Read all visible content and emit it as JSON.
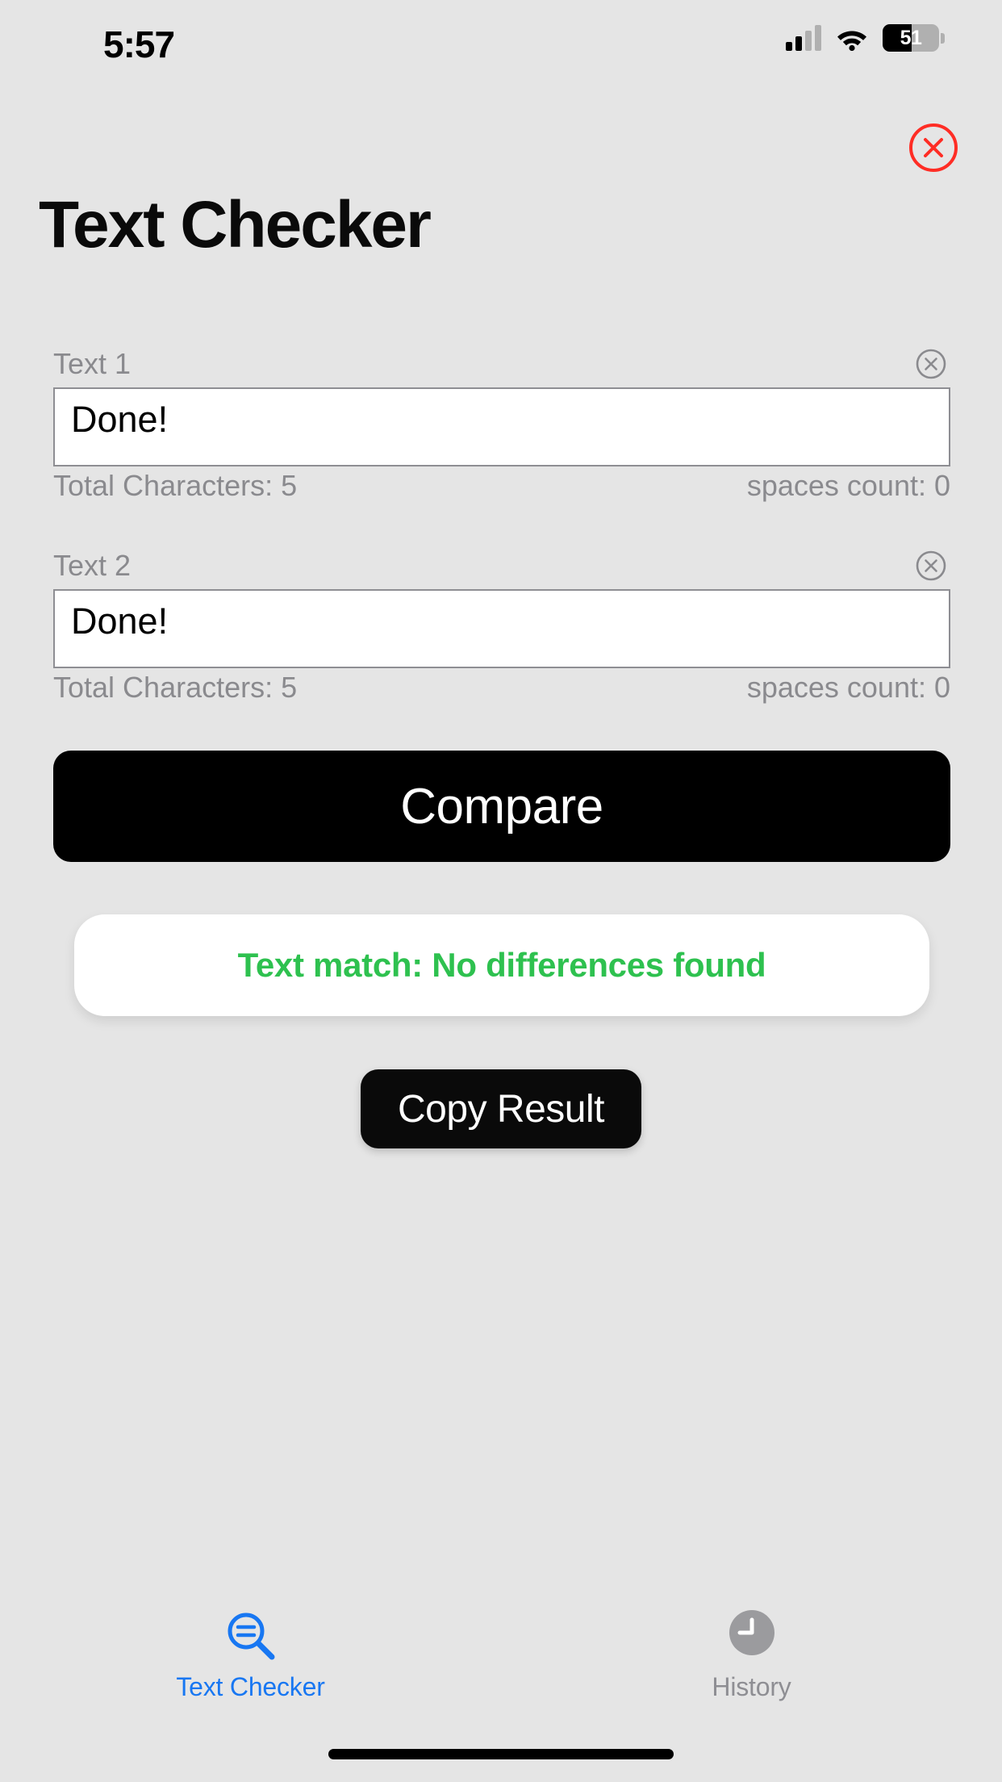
{
  "status_bar": {
    "time": "5:57",
    "signal_icon": "cellular-signal-icon",
    "wifi_icon": "wifi-icon",
    "battery_percent": "51",
    "battery_icon": "battery-icon"
  },
  "header": {
    "title": "Text Checker",
    "close_icon": "close-circle-icon"
  },
  "fields": [
    {
      "label": "Text 1",
      "value": "Done!",
      "placeholder": "",
      "clear_icon": "clear-circle-icon",
      "total_characters": "Total Characters: 5",
      "spaces_count": "spaces count: 0"
    },
    {
      "label": "Text 2",
      "value": "Done!",
      "placeholder": "",
      "clear_icon": "clear-circle-icon",
      "total_characters": "Total Characters: 5",
      "spaces_count": "spaces count: 0"
    }
  ],
  "actions": {
    "compare_label": "Compare",
    "copy_label": "Copy Result"
  },
  "result": {
    "text": "Text match: No differences found",
    "color": "#2ec14f"
  },
  "tab_bar": {
    "tabs": [
      {
        "label": "Text Checker",
        "icon": "text-magnifyingglass-icon",
        "active": true,
        "color": "#1877f2"
      },
      {
        "label": "History",
        "icon": "clock-fill-icon",
        "active": false,
        "color": "#8e8e93"
      }
    ]
  },
  "colors": {
    "background": "#e5e5e5",
    "accent": "#1877f2",
    "success": "#2ec14f",
    "destructive": "#ff2d25",
    "button": "#000000"
  }
}
